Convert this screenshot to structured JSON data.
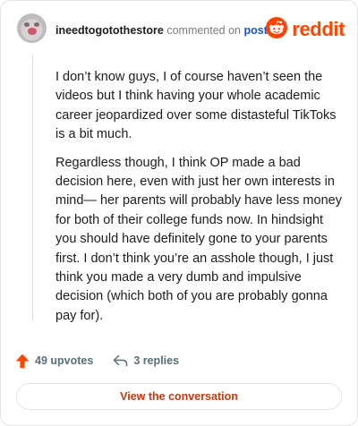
{
  "header": {
    "username": "ineedtogotothestore",
    "action_text": "commented on",
    "post_link": "post",
    "brand_text": "reddit"
  },
  "comment": {
    "paragraphs": [
      "I don’t know guys, I of course haven’t seen the videos but I think having your whole academic career jeopardized over some distasteful TikToks is a bit much.",
      "Regardless though, I think OP made a bad decision here, even with just her own interests in mind— her parents will probably have less money for both of their college funds now. In hindsight you should have definitely gone to your parents first. I don’t think you’re an asshole though, I just think you made a very dumb and impulsive decision (which both of you are probably gonna pay for)."
    ]
  },
  "footer": {
    "upvotes": "49 upvotes",
    "replies": "3 replies",
    "cta": "View the conversation"
  },
  "colors": {
    "brand": "#ff4500",
    "link": "#1a54c5",
    "cta": "#c23a11",
    "action": "#576f76"
  },
  "icons": {
    "avatar": "user-avatar",
    "brand": "reddit-alien-icon",
    "upvote": "upvote-arrow-icon",
    "reply": "reply-arrow-icon"
  }
}
